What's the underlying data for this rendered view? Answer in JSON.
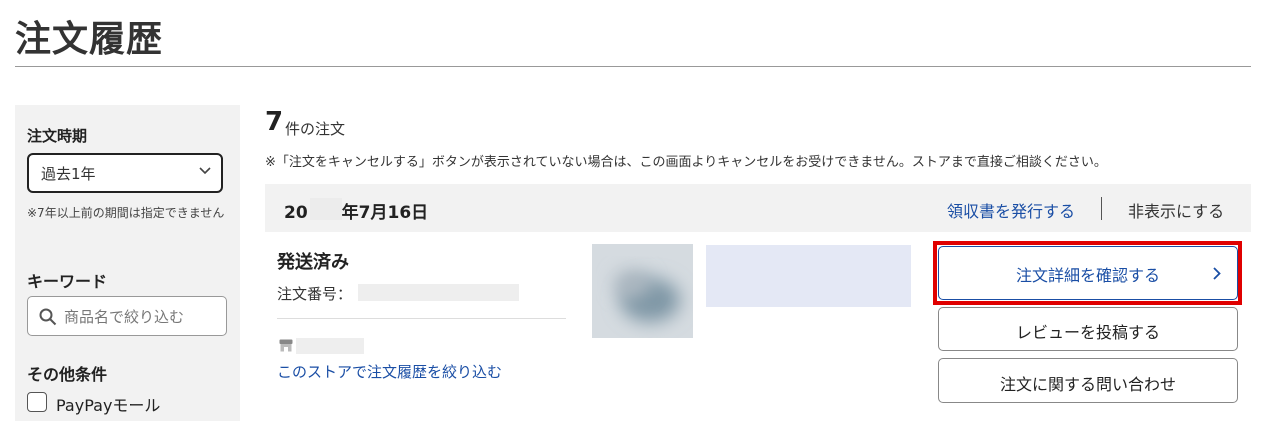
{
  "page": {
    "title": "注文履歴"
  },
  "sidebar": {
    "period_heading": "注文時期",
    "period_select_value": "過去1年",
    "period_note": "※7年以上前の期間は指定できません",
    "keyword_heading": "キーワード",
    "keyword_placeholder": "商品名で絞り込む",
    "other_heading": "その他条件",
    "paypay_checkbox_label": "PayPayモール",
    "paypay_checked": false
  },
  "main": {
    "order_count": "7",
    "order_count_label": "件の注文",
    "cancel_note": "※「注文をキャンセルする」ボタンが表示されていない場合は、この画面よりキャンセルをお受けできません。ストアまで直接ご相談ください。"
  },
  "order": {
    "date": "20　　年7月16日",
    "receipt_link": "領収書を発行する",
    "hide_label": "非表示にする",
    "status": "発送済み",
    "order_number_label": "注文番号：",
    "store_filter_link": "このストアで注文履歴を絞り込む",
    "detail_button": "注文詳細を確認する",
    "review_button": "レビューを投稿する",
    "contact_button": "注文に関する問い合わせ"
  },
  "icons": {
    "select_chevron": "chevron-down-icon",
    "search": "search-icon",
    "store": "store-icon",
    "detail_chevron": "chevron-right-icon"
  },
  "colors": {
    "link": "#1a4ea5",
    "highlight": "#e00000",
    "sidebar_bg": "#f2f2f2",
    "header_bg": "#f2f2f2"
  }
}
